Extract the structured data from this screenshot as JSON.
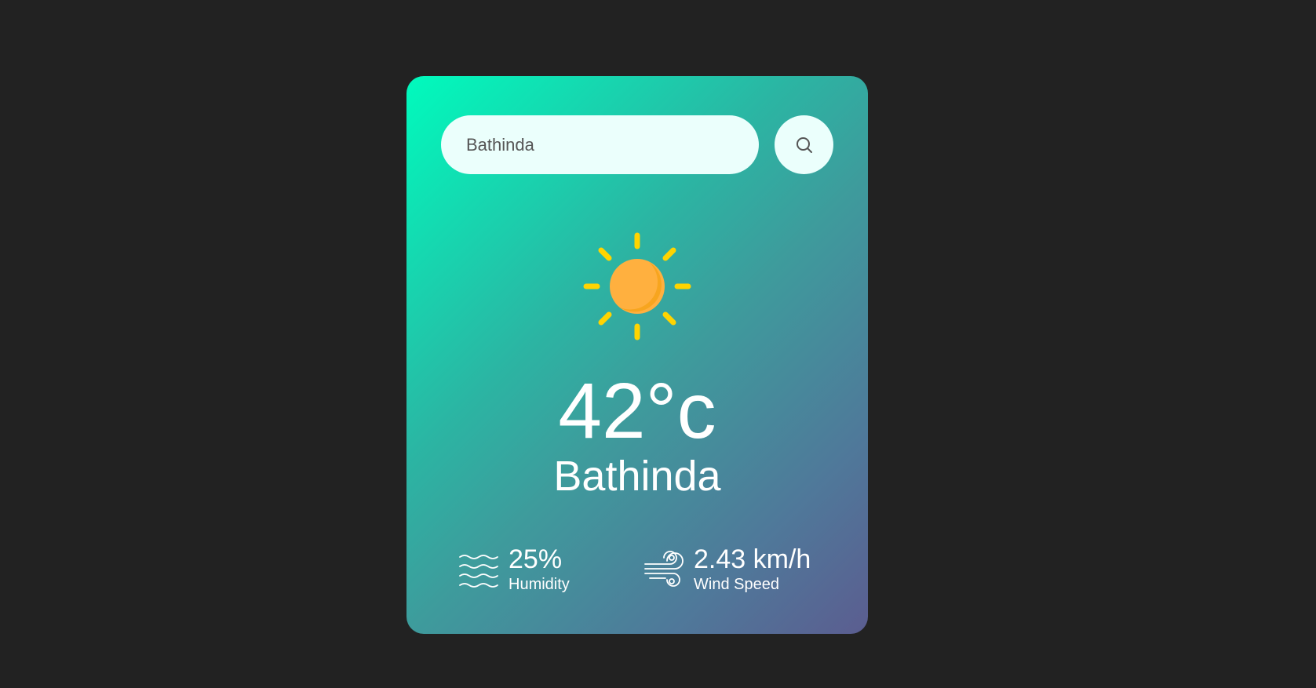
{
  "search": {
    "value": "Bathinda",
    "button_icon": "search-icon"
  },
  "weather": {
    "icon": "sun-icon",
    "temperature": "42°c",
    "city": "Bathinda"
  },
  "details": {
    "humidity": {
      "icon": "humidity-waves-icon",
      "value": "25%",
      "label": "Humidity"
    },
    "wind": {
      "icon": "wind-icon",
      "value": "2.43 km/h",
      "label": "Wind Speed"
    }
  },
  "colors": {
    "page_background": "#222222",
    "card_gradient_start": "#00fbbd",
    "card_gradient_end": "#5b5d90",
    "input_background": "#ebfffc",
    "sun_core": "#ffb03f",
    "sun_rays": "#ffd400"
  }
}
